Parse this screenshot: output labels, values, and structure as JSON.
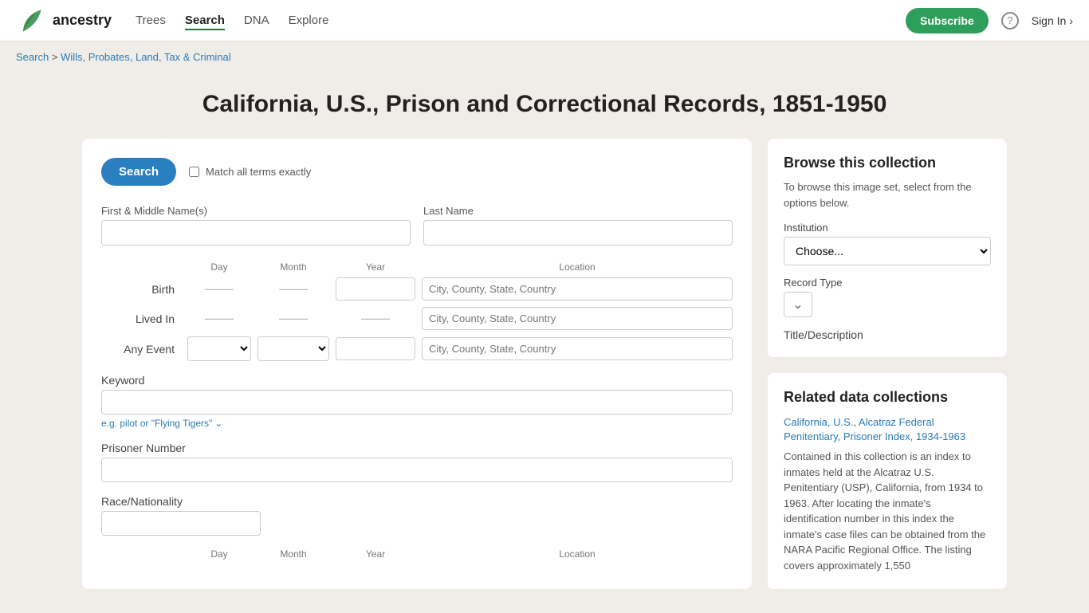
{
  "nav": {
    "logo_text": "ancestry",
    "links": [
      {
        "label": "Trees",
        "active": false
      },
      {
        "label": "Search",
        "active": true
      },
      {
        "label": "DNA",
        "active": false
      },
      {
        "label": "Explore",
        "active": false
      }
    ],
    "subscribe_label": "Subscribe",
    "help_icon": "?",
    "signin_label": "Sign In",
    "signin_arrow": "›"
  },
  "breadcrumb": {
    "search_label": "Search",
    "separator": ">",
    "link_label": "Wills, Probates, Land, Tax & Criminal"
  },
  "page": {
    "title": "California, U.S., Prison and Correctional Records, 1851-1950"
  },
  "search_form": {
    "search_button": "Search",
    "match_exactly_label": "Match all terms exactly",
    "first_name_label": "First & Middle Name(s)",
    "last_name_label": "Last Name",
    "first_name_value": "",
    "last_name_value": "",
    "col_day": "Day",
    "col_month": "Month",
    "col_year": "Year",
    "col_location": "Location",
    "birth_label": "Birth",
    "lived_in_label": "Lived In",
    "any_event_label": "Any Event",
    "location_placeholder": "City, County, State, Country",
    "keyword_label": "Keyword",
    "keyword_placeholder": "",
    "keyword_hint": "e.g. pilot or \"Flying Tigers\"",
    "prisoner_number_label": "Prisoner Number",
    "prisoner_number_value": "",
    "race_label": "Race/Nationality",
    "race_value": "",
    "bottom_col_day": "Day",
    "bottom_col_month": "Month",
    "bottom_col_year": "Year",
    "bottom_col_location": "Location"
  },
  "browse": {
    "title": "Browse this collection",
    "description": "To browse this image set, select from the options below.",
    "institution_label": "Institution",
    "institution_placeholder": "Choose...",
    "record_type_label": "Record Type",
    "title_desc_label": "Title/Description"
  },
  "related": {
    "title": "Related data collections",
    "link_text": "California, U.S., Alcatraz Federal Penitentiary, Prisoner Index, 1934-1963",
    "description": "Contained in this collection is an index to inmates held at the Alcatraz U.S. Penitentiary (USP), California, from 1934 to 1963. After locating the inmate's identification number in this index the inmate's case files can be obtained from the NARA Pacific Regional Office. The listing covers approximately 1,550"
  }
}
